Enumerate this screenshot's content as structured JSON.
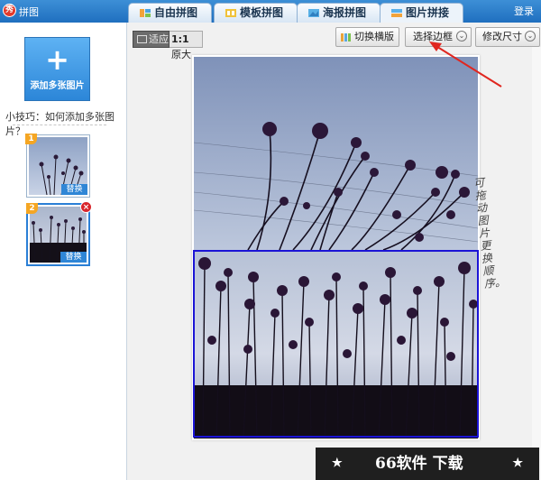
{
  "app": {
    "title": "拼图",
    "logo_glyph": "秀",
    "login": "登录"
  },
  "tabs": [
    {
      "label": "自由拼图",
      "icon": "free-collage-icon"
    },
    {
      "label": "模板拼图",
      "icon": "template-collage-icon"
    },
    {
      "label": "海报拼图",
      "icon": "poster-collage-icon"
    },
    {
      "label": "图片拼接",
      "icon": "image-stitch-icon",
      "active": true
    }
  ],
  "sidebar": {
    "add_button": {
      "icon": "+",
      "label": "添加多张图片"
    },
    "tip": "小技巧：如何添加多张图片？",
    "thumbnails": [
      {
        "index": "1",
        "action": "替换",
        "selected": false
      },
      {
        "index": "2",
        "action": "替换",
        "selected": true,
        "close": "×"
      }
    ]
  },
  "toolbar": {
    "fit_label": "适应",
    "original_label": "原大",
    "original_prefix": "1:1",
    "switch_layout": "切换横版",
    "select_border": "选择边框",
    "resize": "修改尺寸"
  },
  "annotation": {
    "note": "可拖动图片更换顺序。"
  },
  "watermark": {
    "text": "66软件 下载",
    "star": "★"
  },
  "colors": {
    "accent": "#2c86d8",
    "titlebar": "#1f6fbf",
    "frame": "#1b14d6",
    "arrow": "#e0261f"
  }
}
